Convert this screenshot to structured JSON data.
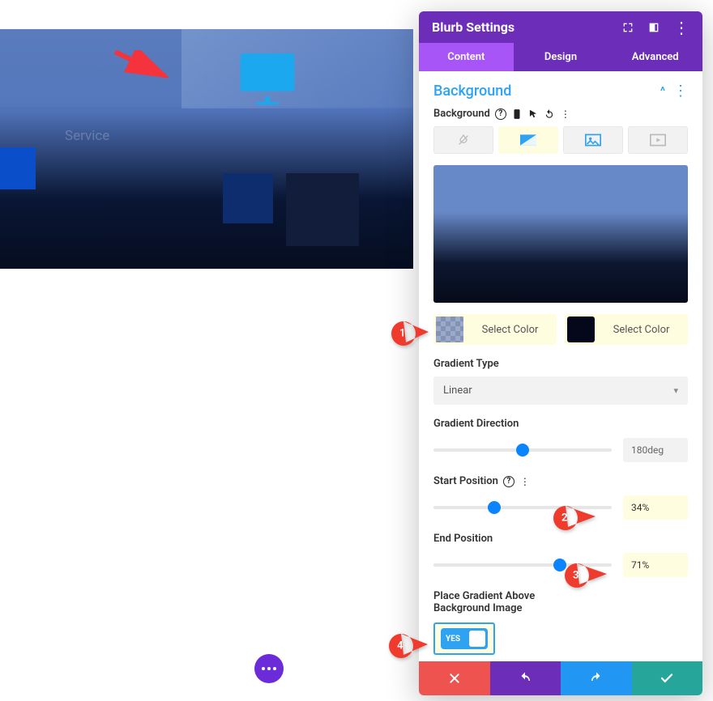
{
  "preview": {
    "service_label": "Service"
  },
  "panel": {
    "title": "Blurb Settings",
    "tabs": [
      "Content",
      "Design",
      "Advanced"
    ],
    "active_tab": 0,
    "section_title": "Background",
    "background_label": "Background",
    "background_type_icons": [
      "color-drop-icon",
      "gradient-icon",
      "image-icon",
      "video-icon"
    ],
    "background_type_active": 1,
    "color1_label": "Select Color",
    "color2_label": "Select Color",
    "gradient_type_label": "Gradient Type",
    "gradient_type_value": "Linear",
    "gradient_direction_label": "Gradient Direction",
    "gradient_direction_value": "180deg",
    "gradient_direction_percent": 50,
    "start_position_label": "Start Position",
    "start_position_value": "34%",
    "start_position_percent": 34,
    "end_position_label": "End Position",
    "end_position_value": "71%",
    "end_position_percent": 71,
    "place_above_label_l1": "Place Gradient Above",
    "place_above_label_l2": "Background Image",
    "toggle_label": "YES"
  },
  "callouts": {
    "c1": "1",
    "c2": "2",
    "c3": "3",
    "c4": "4"
  },
  "chart_data": {
    "type": "gradient-settings",
    "gradient_type": "Linear",
    "direction_deg": 180,
    "start_position_pct": 34,
    "end_position_pct": 71,
    "place_above_image": true
  }
}
